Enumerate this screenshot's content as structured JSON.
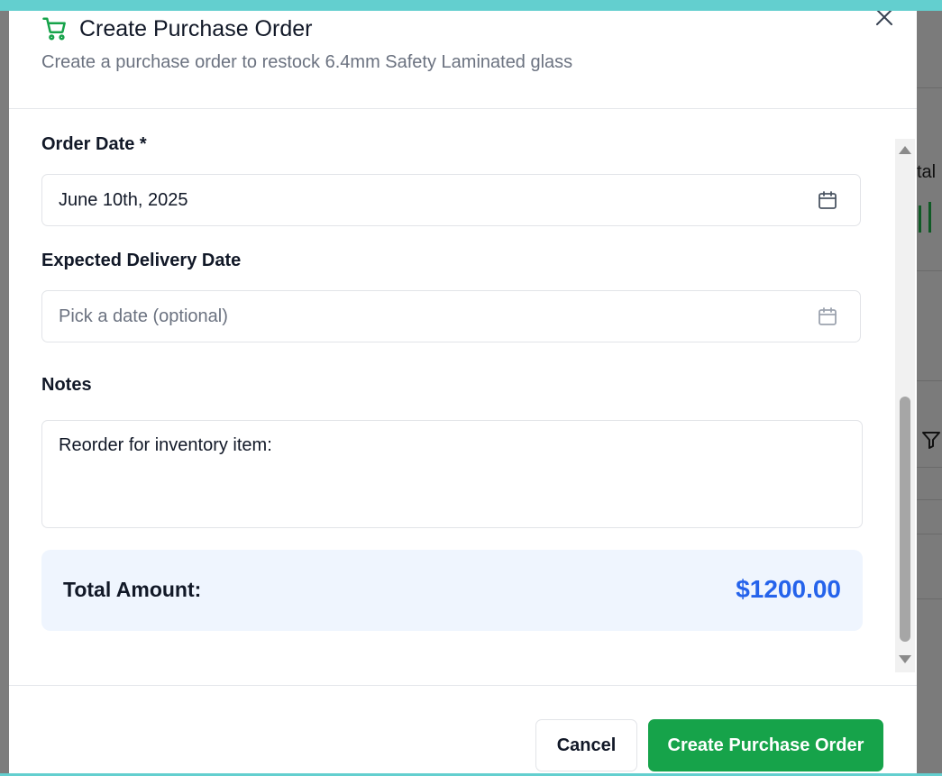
{
  "dialog": {
    "title": "Create Purchase Order",
    "subtitle": "Create a purchase order to restock 6.4mm Safety Laminated glass",
    "close_icon": "close-icon",
    "header_icon": "shopping-cart-icon"
  },
  "form": {
    "order_date": {
      "label": "Order Date *",
      "value": "June 10th, 2025",
      "icon": "calendar-icon"
    },
    "delivery_date": {
      "label": "Expected Delivery Date",
      "placeholder": "Pick a date (optional)",
      "icon": "calendar-icon"
    },
    "notes": {
      "label": "Notes",
      "value": "Reorder for inventory item:"
    },
    "total": {
      "label": "Total Amount:",
      "value": "$1200.00"
    }
  },
  "footer": {
    "cancel_label": "Cancel",
    "create_label": "Create Purchase Order"
  },
  "background": {
    "right_fragment": "tal"
  },
  "colors": {
    "accent_green": "#16a34a",
    "total_blue": "#2563eb",
    "total_bg": "#eff5fe",
    "top_bar": "#63cfcf"
  }
}
